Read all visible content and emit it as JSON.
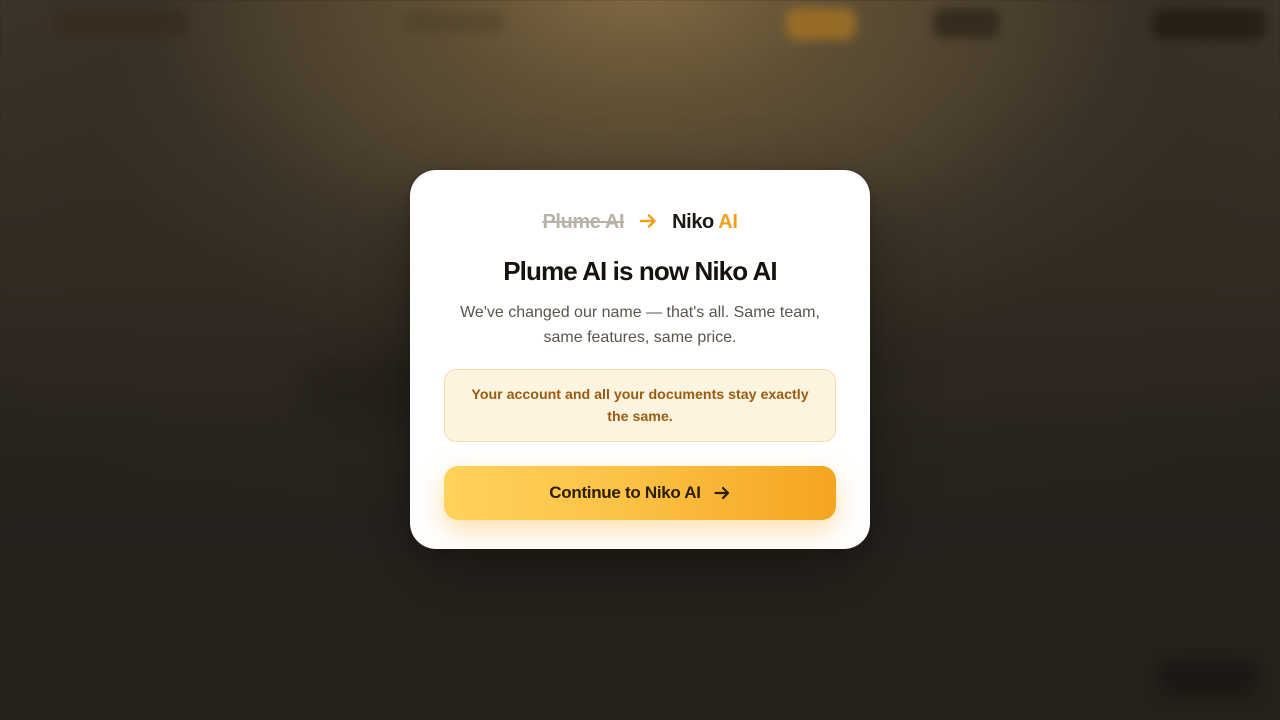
{
  "background": {
    "blurred": true
  },
  "modal": {
    "old_name": "Plume AI",
    "new_name_main": "Niko",
    "new_name_accent": "AI",
    "title": "Plume AI is now Niko AI",
    "subtitle": "We've changed our name — that's all. Same team, same features, same price.",
    "notice": "Your account and all your documents stay exactly the same.",
    "continue_label": "Continue to Niko AI",
    "icons": {
      "rename_arrow": "arrow-right-icon",
      "button_arrow": "arrow-right-icon"
    }
  },
  "colors": {
    "accent": "#f0a21e",
    "button_start": "#ffd25c",
    "button_end": "#f5a520",
    "notice_bg": "#fcf4de",
    "notice_text": "#9a5b12"
  }
}
